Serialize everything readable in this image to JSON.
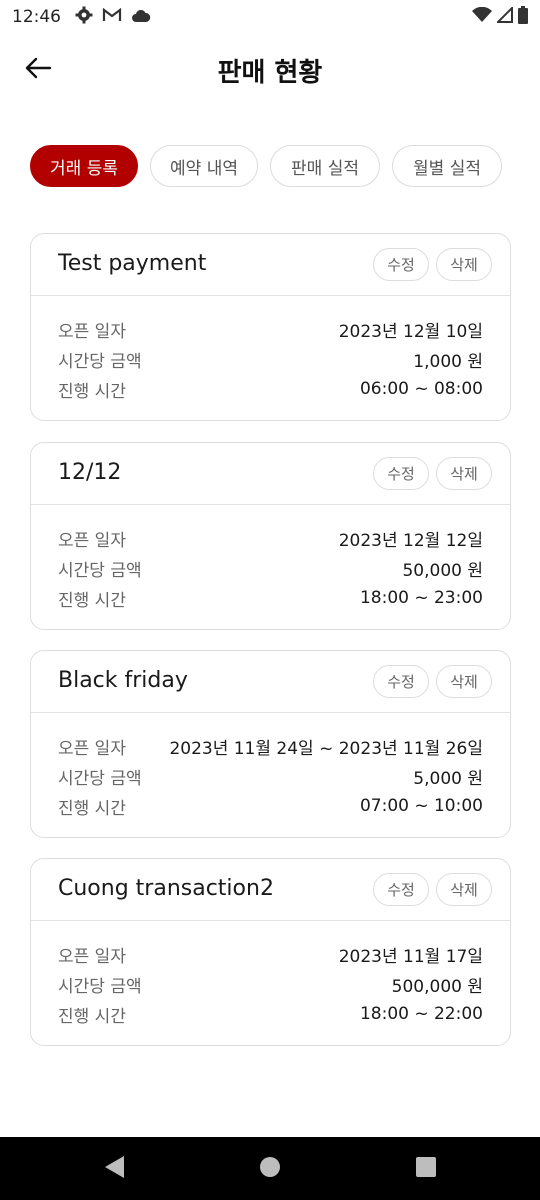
{
  "status_bar": {
    "time": "12:46"
  },
  "header": {
    "title": "판매 현황"
  },
  "tabs": [
    {
      "label": "거래 등록",
      "active": true
    },
    {
      "label": "예약 내역",
      "active": false
    },
    {
      "label": "판매 실적",
      "active": false
    },
    {
      "label": "월별 실적",
      "active": false
    }
  ],
  "row_labels": {
    "open_date": "오픈 일자",
    "hourly_price": "시간당 금액",
    "session_time": "진행 시간"
  },
  "actions": {
    "edit": "수정",
    "delete": "삭제"
  },
  "cards": [
    {
      "title": "Test payment",
      "open_date": "2023년 12월 10일",
      "hourly_price": "1,000 원",
      "session_time": "06:00 ~ 08:00"
    },
    {
      "title": "12/12",
      "open_date": "2023년 12월 12일",
      "hourly_price": "50,000 원",
      "session_time": "18:00 ~ 23:00"
    },
    {
      "title": "Black friday",
      "open_date": "2023년 11월 24일 ~ 2023년 11월 26일",
      "hourly_price": "5,000 원",
      "session_time": "07:00 ~ 10:00"
    },
    {
      "title": "Cuong transaction2",
      "open_date": "2023년 11월 17일",
      "hourly_price": "500,000 원",
      "session_time": "18:00 ~ 22:00"
    }
  ],
  "colors": {
    "accent": "#b20000",
    "border": "#dedede",
    "label": "#666666"
  }
}
